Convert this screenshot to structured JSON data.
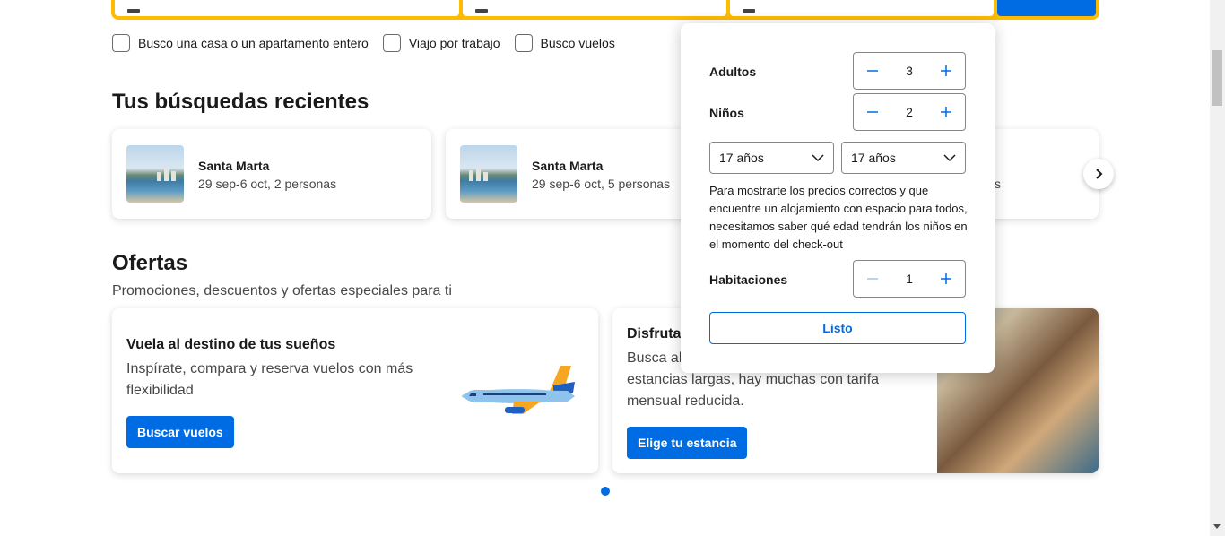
{
  "checkboxes": [
    {
      "label": "Busco una casa o un apartamento entero"
    },
    {
      "label": "Viajo por trabajo"
    },
    {
      "label": "Busco vuelos"
    }
  ],
  "recent": {
    "title": "Tus búsquedas recientes",
    "items": [
      {
        "destination": "Santa Marta",
        "details": "29 sep-6 oct, 2 personas"
      },
      {
        "destination": "Santa Marta",
        "details": "29 sep-6 oct, 5 personas"
      },
      {
        "destination": "",
        "details": "s"
      }
    ]
  },
  "offers": {
    "title": "Ofertas",
    "subtitle": "Promociones, descuentos y ofertas especiales para ti",
    "cards": [
      {
        "title": "Vuela al destino de tus sueños",
        "text_line1": "Inspírate, compara y reserva vuelos con más",
        "text_line2": "flexibilidad",
        "button": "Buscar vuelos"
      },
      {
        "title": "Disfruta",
        "text_line1": "Busca alo",
        "text_line2": "estancias largas, hay muchas con tarifa",
        "text_line3": "mensual reducida.",
        "button": "Elige tu estancia"
      }
    ]
  },
  "occupancy": {
    "adults": {
      "label": "Adultos",
      "value": "3"
    },
    "children": {
      "label": "Niños",
      "value": "2"
    },
    "child_ages": [
      "17 años",
      "17 años"
    ],
    "info": "Para mostrarte los precios correctos y que encuentre un alojamiento con espacio para todos, necesitamos saber qué edad tendrán los niños en el momento del check-out",
    "rooms": {
      "label": "Habitaciones",
      "value": "1"
    },
    "done_button": "Listo"
  },
  "colors": {
    "brand_blue": "#006ce4",
    "search_yellow": "#febb02"
  }
}
